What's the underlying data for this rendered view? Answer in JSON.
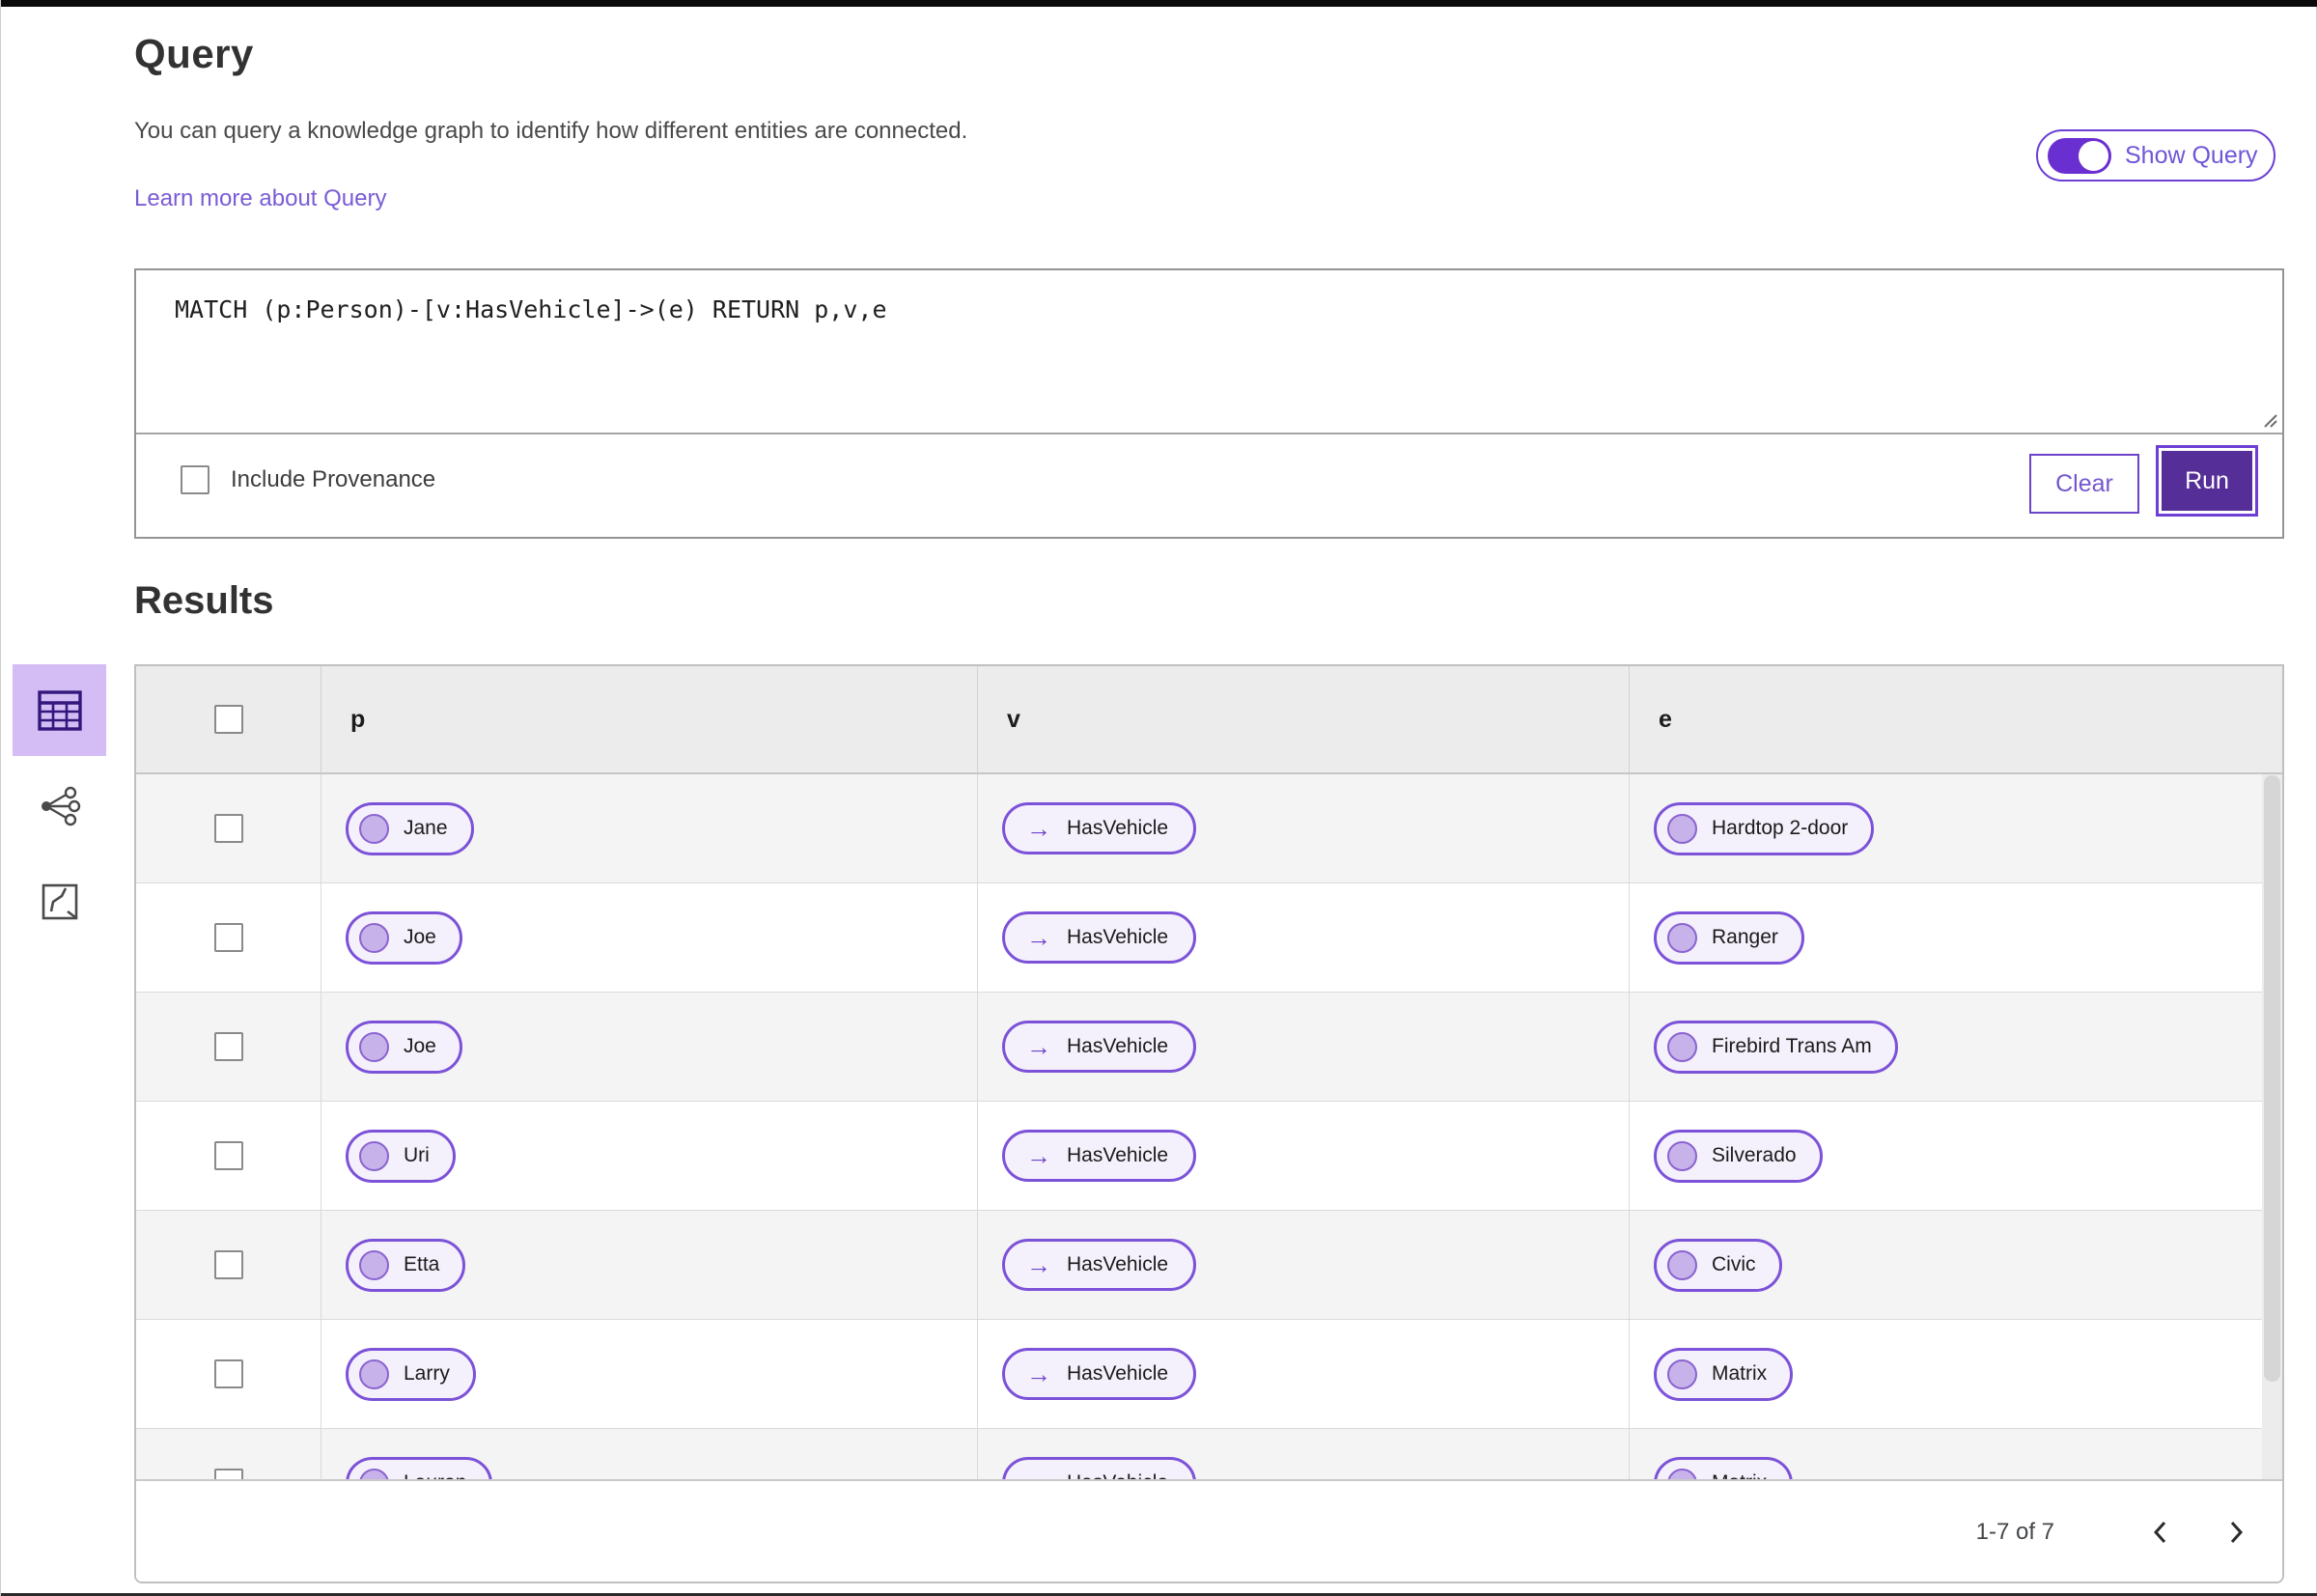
{
  "query_section": {
    "title": "Query",
    "description": "You can query a knowledge graph to identify how different entities are connected.",
    "learn_more": "Learn more about Query",
    "show_query_label": "Show Query",
    "show_query_on": true,
    "query_text": "MATCH (p:Person)-[v:HasVehicle]->(e) RETURN p,v,e",
    "include_provenance_label": "Include Provenance",
    "include_provenance_checked": false,
    "clear_label": "Clear",
    "run_label": "Run"
  },
  "results_section": {
    "title": "Results",
    "view_modes": [
      {
        "name": "table-view",
        "active": true
      },
      {
        "name": "graph-view",
        "active": false
      },
      {
        "name": "map-view",
        "active": false
      }
    ],
    "table": {
      "columns": [
        "p",
        "v",
        "e"
      ],
      "rows": [
        {
          "p": "Jane",
          "v": "HasVehicle",
          "e": "Hardtop 2-door"
        },
        {
          "p": "Joe",
          "v": "HasVehicle",
          "e": "Ranger"
        },
        {
          "p": "Joe",
          "v": "HasVehicle",
          "e": "Firebird Trans Am"
        },
        {
          "p": "Uri",
          "v": "HasVehicle",
          "e": "Silverado"
        },
        {
          "p": "Etta",
          "v": "HasVehicle",
          "e": "Civic"
        },
        {
          "p": "Larry",
          "v": "HasVehicle",
          "e": "Matrix"
        },
        {
          "p": "Lauren",
          "v": "HasVehicle",
          "e": "Matrix"
        }
      ],
      "pagination": {
        "range_label": "1-7 of 7"
      }
    }
  },
  "colors": {
    "accent_purple": "#6b3fd4",
    "run_button_fill": "#562e97",
    "pill_border": "#7c52d8",
    "pill_background": "#f5f1fc",
    "active_view_background": "#d3bdf4",
    "link": "#7a5cd6",
    "table_header_background": "#ececec",
    "row_stripe": "#f4f4f4"
  }
}
